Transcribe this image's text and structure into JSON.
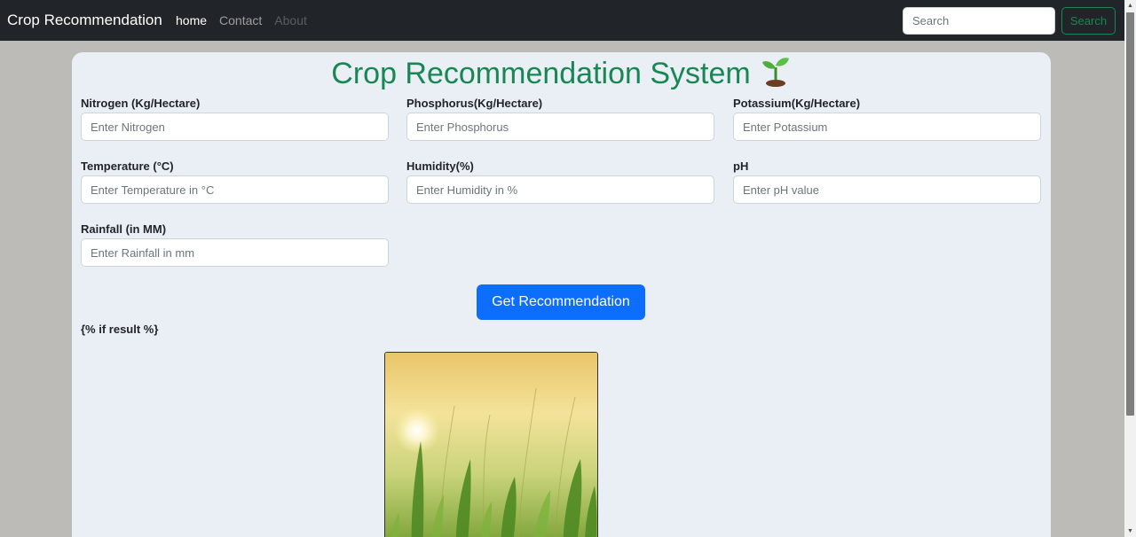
{
  "navbar": {
    "brand": "Crop Recommendation",
    "links": [
      {
        "label": "home",
        "state": "active"
      },
      {
        "label": "Contact",
        "state": "normal"
      },
      {
        "label": "About",
        "state": "disabled"
      }
    ],
    "search": {
      "placeholder": "Search",
      "value": "",
      "button_label": "Search"
    }
  },
  "main": {
    "title": "Crop Recommendation System",
    "title_icon": "seedling-icon",
    "fields": [
      {
        "label": "Nitrogen (Kg/Hectare)",
        "placeholder": "Enter Nitrogen",
        "value": ""
      },
      {
        "label": "Phosphorus(Kg/Hectare)",
        "placeholder": "Enter Phosphorus",
        "value": ""
      },
      {
        "label": "Potassium(Kg/Hectare)",
        "placeholder": "Enter Potassium",
        "value": ""
      },
      {
        "label": "Temperature (°C)",
        "placeholder": "Enter Temperature in °C",
        "value": ""
      },
      {
        "label": "Humidity(%)",
        "placeholder": "Enter Humidity in %",
        "value": ""
      },
      {
        "label": "pH",
        "placeholder": "Enter pH value",
        "value": ""
      },
      {
        "label": "Rainfall (in MM)",
        "placeholder": "Enter Rainfall in mm",
        "value": ""
      }
    ],
    "submit_label": "Get Recommendation",
    "result_template": "{% if result %}"
  },
  "colors": {
    "accent_green": "#198754",
    "primary_blue": "#0d6efd",
    "navbar_bg": "#212529",
    "card_bg": "#eaeff5"
  }
}
